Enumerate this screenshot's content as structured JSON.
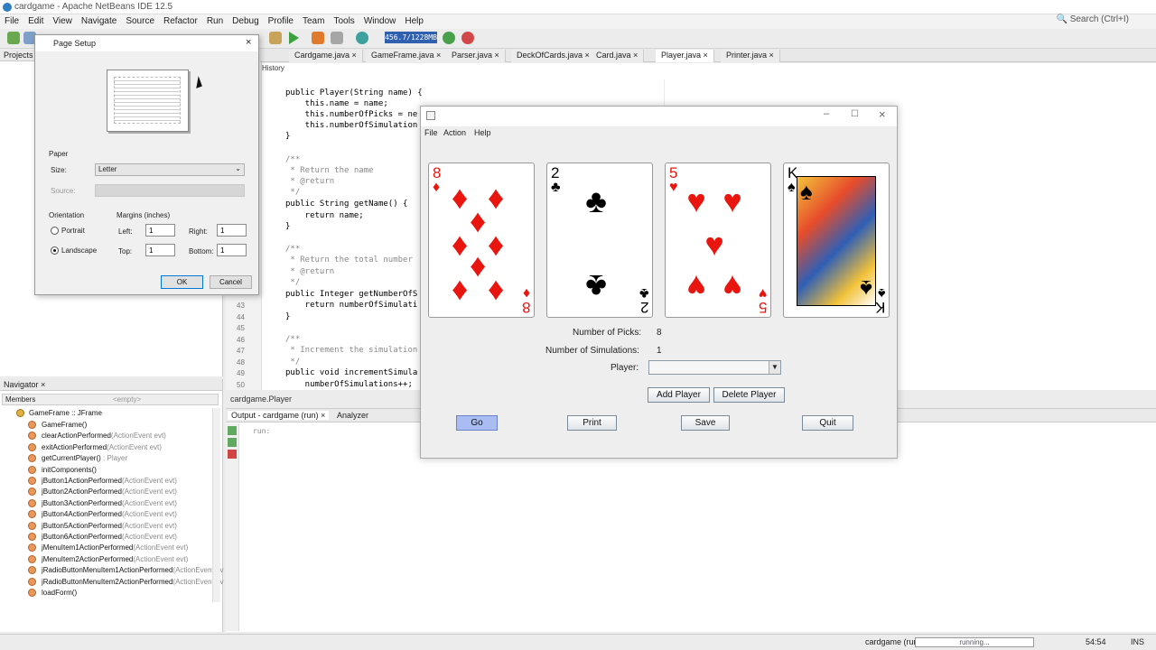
{
  "window": {
    "title": "cardgame - Apache NetBeans IDE 12.5"
  },
  "menu": [
    "File",
    "Edit",
    "View",
    "Navigate",
    "Source",
    "Refactor",
    "Run",
    "Debug",
    "Profile",
    "Team",
    "Tools",
    "Window",
    "Help"
  ],
  "search_placeholder": "Search (Ctrl+I)",
  "heap": "456.7/1228MB",
  "editor_tabs": [
    "Cardgame.java",
    "GameFrame.java",
    "Parser.java",
    "DeckOfCards.java",
    "Card.java",
    "Player.java",
    "Printer.java"
  ],
  "editor_toolbar": {
    "history": "History"
  },
  "code": [
    {
      "n": "",
      "text": "public Player(String name) {"
    },
    {
      "n": "",
      "text": "    this.name = name;"
    },
    {
      "n": "",
      "text": "    this.numberOfPicks = ne"
    },
    {
      "n": "",
      "text": "    this.numberOfSimulation"
    },
    {
      "n": "",
      "text": "}"
    },
    {
      "n": "",
      "text": "/**"
    },
    {
      "n": "",
      "text": " * Return the name"
    },
    {
      "n": "",
      "text": " * @return"
    },
    {
      "n": "",
      "text": " */"
    },
    {
      "n": "",
      "text": "public String getName() {"
    },
    {
      "n": "",
      "text": "    return name;"
    },
    {
      "n": "",
      "text": "}"
    },
    {
      "n": "",
      "text": "/**"
    },
    {
      "n": "",
      "text": " * Return the total number"
    },
    {
      "n": "",
      "text": " * @return"
    },
    {
      "n": "",
      "text": " */"
    },
    {
      "n": "",
      "text": "public Integer getNumberOfS"
    },
    {
      "n": "43",
      "text": "    return numberOfSimulati"
    },
    {
      "n": "44",
      "text": "}"
    },
    {
      "n": "45",
      "text": ""
    },
    {
      "n": "46",
      "text": "/**"
    },
    {
      "n": "47",
      "text": " * Increment the simulation"
    },
    {
      "n": "48",
      "text": " */"
    },
    {
      "n": "49",
      "text": "public void incrementSimula"
    },
    {
      "n": "50",
      "text": "    numberOfSimulations++;"
    }
  ],
  "breadcrumb": "cardgame.Player",
  "projects_tab": "Projects",
  "navigator": {
    "tab": "Navigator",
    "members_label": "Members",
    "filter": "<empty>",
    "root": "GameFrame :: JFrame",
    "items": [
      {
        "name": "GameFrame()",
        "type": ""
      },
      {
        "name": "clearActionPerformed",
        "type": "(ActionEvent evt)"
      },
      {
        "name": "exitActionPerformed",
        "type": "(ActionEvent evt)"
      },
      {
        "name": "getCurrentPlayer()",
        "type": " : Player"
      },
      {
        "name": "initComponents()",
        "type": ""
      },
      {
        "name": "jButton1ActionPerformed",
        "type": "(ActionEvent evt)"
      },
      {
        "name": "jButton2ActionPerformed",
        "type": "(ActionEvent evt)"
      },
      {
        "name": "jButton3ActionPerformed",
        "type": "(ActionEvent evt)"
      },
      {
        "name": "jButton4ActionPerformed",
        "type": "(ActionEvent evt)"
      },
      {
        "name": "jButton5ActionPerformed",
        "type": "(ActionEvent evt)"
      },
      {
        "name": "jButton6ActionPerformed",
        "type": "(ActionEvent evt)"
      },
      {
        "name": "jMenuItem1ActionPerformed",
        "type": "(ActionEvent evt)"
      },
      {
        "name": "jMenuItem2ActionPerformed",
        "type": "(ActionEvent evt)"
      },
      {
        "name": "jRadioButtonMenuItem1ActionPerformed",
        "type": "(ActionEvent ev"
      },
      {
        "name": "jRadioButtonMenuItem2ActionPerformed",
        "type": "(ActionEvent ev"
      },
      {
        "name": "loadForm()",
        "type": ""
      }
    ]
  },
  "output": {
    "tab": "Output - cardgame (run)",
    "tab2": "Analyzer",
    "text": "run:"
  },
  "status": {
    "task": "cardgame (run)",
    "progress": "running...",
    "position": "54:54",
    "mode": "INS"
  },
  "page_setup": {
    "title": "Page Setup",
    "paper_label": "Paper",
    "size_label": "Size:",
    "size_value": "Letter",
    "source_label": "Source:",
    "orientation_label": "Orientation",
    "portrait": "Portrait",
    "landscape": "Landscape",
    "margins_label": "Margins (inches)",
    "left_label": "Left:",
    "left": "1",
    "right_label": "Right:",
    "right": "1",
    "top_label": "Top:",
    "top": "1",
    "bottom_label": "Bottom:",
    "bottom": "1",
    "ok": "OK",
    "cancel": "Cancel"
  },
  "card_game": {
    "menu": [
      "File",
      "Action",
      "Help"
    ],
    "cards": [
      {
        "rank": "8",
        "suit": "♦",
        "color": "#e8160f"
      },
      {
        "rank": "2",
        "suit": "♣",
        "color": "#000000"
      },
      {
        "rank": "5",
        "suit": "♥",
        "color": "#e8160f"
      },
      {
        "rank": "K",
        "suit": "♠",
        "color": "#000000"
      }
    ],
    "picks_label": "Number of Picks:",
    "picks_value": "8",
    "sims_label": "Number of Simulations:",
    "sims_value": "1",
    "player_label": "Player:",
    "player_value": "",
    "add_player": "Add Player",
    "delete_player": "Delete Player",
    "go": "Go",
    "print": "Print",
    "save": "Save",
    "quit": "Quit"
  }
}
